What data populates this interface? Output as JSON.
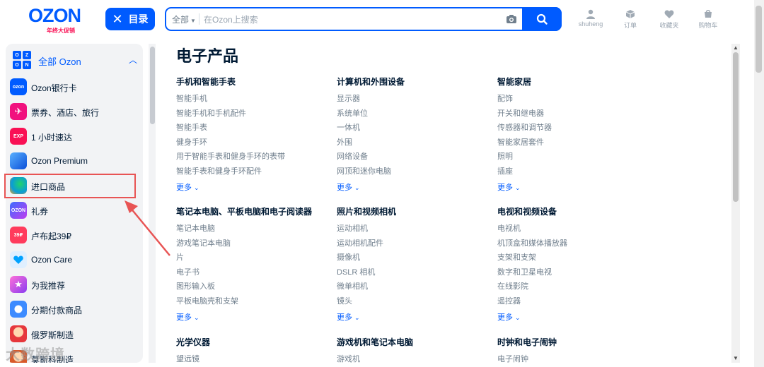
{
  "header": {
    "logo_text": "OZON",
    "logo_sub": "年终大促销",
    "catalog_label": "目录",
    "search": {
      "scope": "全部",
      "placeholder": "在Ozon上搜索"
    },
    "icons": [
      {
        "name": "user-icon",
        "label": "shuheng"
      },
      {
        "name": "box-icon",
        "label": "订单"
      },
      {
        "name": "heart-icon",
        "label": "收藏夹"
      },
      {
        "name": "cart-icon",
        "label": "购物车"
      }
    ]
  },
  "sidebar": {
    "head_label": "全部 Ozon",
    "head_icon_letters": [
      "O",
      "Z",
      "O",
      "N"
    ],
    "items": [
      {
        "label": "Ozon银行卡",
        "icon": "bank-card-icon",
        "icon_text": "ozon",
        "color": "#005bff"
      },
      {
        "label": "票券、酒店、旅行",
        "icon": "plane-icon",
        "icon_text": "✈",
        "color": "#f1117e"
      },
      {
        "label": "1 小时速达",
        "icon": "express-icon",
        "icon_text": "EXP",
        "color": "#f91155"
      },
      {
        "label": "Ozon Premium",
        "icon": "premium-icon",
        "icon_text": "",
        "color": "#2a7bff"
      },
      {
        "label": "进口商品",
        "icon": "global-icon",
        "icon_text": "",
        "color": "#19b25b"
      },
      {
        "label": "礼券",
        "icon": "gift-card-icon",
        "icon_text": "OZON",
        "color": "#6f3bf5"
      },
      {
        "label": "卢布起39₽",
        "icon": "price-tag-icon",
        "icon_text": "39₽",
        "color": "#ff3b5c"
      },
      {
        "label": "Ozon Care",
        "icon": "care-icon",
        "icon_text": "",
        "color": "#00a2ff"
      },
      {
        "label": "为我推荐",
        "icon": "star-icon",
        "icon_text": "★",
        "color": "#d13cf0"
      },
      {
        "label": "分期付款商品",
        "icon": "installment-icon",
        "icon_text": "",
        "color": "#3d8bff"
      },
      {
        "label": "俄罗斯制造",
        "icon": "russia-icon",
        "icon_text": "",
        "color": "#e6373c"
      },
      {
        "label": "莫斯科制造",
        "icon": "moscow-icon",
        "icon_text": "",
        "color": "#d85a2a"
      }
    ]
  },
  "main": {
    "title": "电子产品",
    "more_label": "更多",
    "sections": [
      {
        "title": "手机和智能手表",
        "items": [
          "智能手机",
          "智能手机和手机配件",
          "智能手表",
          "健身手环",
          "用于智能手表和健身手环的表带",
          "智能手表和健身手环配件"
        ]
      },
      {
        "title": "计算机和外围设备",
        "items": [
          "显示器",
          "系统单位",
          "一体机",
          "外围",
          "网络设备",
          "网顶和迷你电脑"
        ]
      },
      {
        "title": "智能家居",
        "items": [
          "配饰",
          "开关和继电器",
          "传感器和调节器",
          "智能家居套件",
          "照明",
          "插座"
        ]
      },
      {
        "title": "笔记本电脑、平板电脑和电子阅读器",
        "items": [
          "笔记本电脑",
          "游戏笔记本电脑",
          "片",
          "电子书",
          "图形输入板",
          "平板电脑壳和支架"
        ]
      },
      {
        "title": "照片和视频相机",
        "items": [
          "运动相机",
          "运动相机配件",
          "摄像机",
          "DSLR 相机",
          "微单相机",
          "镜头"
        ]
      },
      {
        "title": "电视和视频设备",
        "items": [
          "电视机",
          "机顶盒和媒体播放器",
          "支架和支架",
          "数字和卫星电视",
          "在线影院",
          "遥控器"
        ]
      },
      {
        "title": "光学仪器",
        "items": [
          "望远镜"
        ]
      },
      {
        "title": "游戏机和笔记本电脑",
        "items": [
          "游戏机"
        ]
      },
      {
        "title": "时钟和电子闹钟",
        "items": [
          "电子闹钟"
        ]
      }
    ]
  },
  "watermark": "大数跨境",
  "colors": {
    "brand": "#005bff",
    "highlight": "#e85454",
    "text": "#001a34",
    "muted": "#707f8d"
  }
}
